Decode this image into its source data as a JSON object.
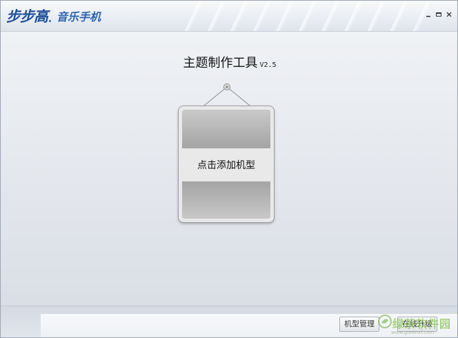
{
  "app": {
    "brand": "步步高",
    "brand_sub": "音乐手机"
  },
  "window_controls": {
    "minimize_icon": "minimize-icon",
    "restore_icon": "restore-icon",
    "close_icon": "close-icon"
  },
  "main": {
    "title": "主题制作工具",
    "version": "V2.5",
    "add_model_label": "点击添加机型"
  },
  "footer": {
    "model_manage_label": "机型管理",
    "upgrade_label": "在线升级"
  },
  "watermark": {
    "text": "绿茶软件园",
    "url": "www.greenxf.com"
  },
  "colors": {
    "brand_blue": "#1d4f9c",
    "background": "#e6e9ee",
    "sign_gray": "#a4a4a4"
  }
}
